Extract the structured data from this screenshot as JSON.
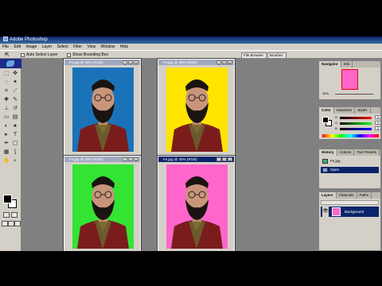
{
  "app": {
    "title": "Adobe Photoshop",
    "menu": [
      "File",
      "Edit",
      "Image",
      "Layer",
      "Select",
      "Filter",
      "View",
      "Window",
      "Help"
    ]
  },
  "options_bar": {
    "auto_select_label": "Auto Select Layer",
    "bounding_box_label": "Show Bounding Box",
    "well_tabs": [
      "File Browser",
      "Brushes"
    ]
  },
  "documents": [
    {
      "title": "Fe.jpg @ 45% (RGB)",
      "background": "#1a73b8"
    },
    {
      "title": "Fe.jpg @ 45% (RGB)",
      "background": "#ffe400"
    },
    {
      "title": "Fe.jpg @ 45% (RGB)",
      "background": "#33e433"
    },
    {
      "title": "Fe.jpg @ 45% (RGB)",
      "background": "#ff66cc"
    }
  ],
  "panels": {
    "navigator": {
      "tabs": [
        "Navigator",
        "Info"
      ],
      "zoom": "45%"
    },
    "color": {
      "tabs": [
        "Color",
        "Swatches",
        "Styles"
      ],
      "channels": [
        {
          "label": "R",
          "value": "0"
        },
        {
          "label": "G",
          "value": "0"
        },
        {
          "label": "B",
          "value": "0"
        }
      ]
    },
    "history": {
      "tabs": [
        "History",
        "Actions",
        "Tool Presets"
      ],
      "items": [
        "Fe.jpg",
        "Open"
      ]
    },
    "layers": {
      "tabs": [
        "Layers",
        "Channels",
        "Paths"
      ],
      "layer_name": "Background"
    }
  },
  "colors": {
    "workspace": "#808080",
    "chrome": "#d4d0c8",
    "selection": "#0a246a"
  }
}
